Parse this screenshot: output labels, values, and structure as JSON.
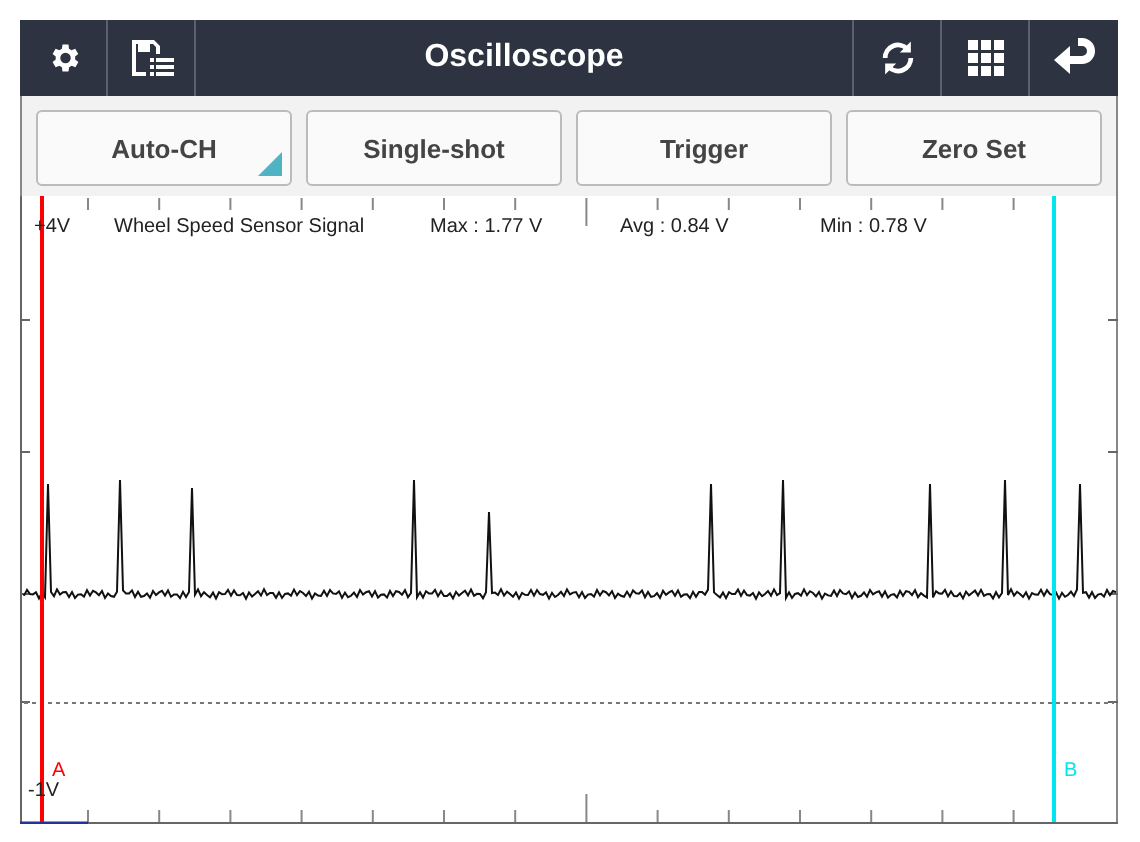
{
  "window": {
    "title": "Oscilloscope"
  },
  "buttons": [
    {
      "label": "Auto-CH",
      "kind": "dropdown"
    },
    {
      "label": "Single-shot",
      "kind": "plain"
    },
    {
      "label": "Trigger",
      "kind": "plain"
    },
    {
      "label": "Zero Set",
      "kind": "plain"
    }
  ],
  "plot": {
    "y_max_label": "+4V",
    "y_min_label": "-1V",
    "signal": "Wheel Speed Sensor Signal",
    "max": "Max : 1.77 V",
    "avg": "Avg : 0.84 V",
    "min": "Min : 0.78 V",
    "cursors": [
      {
        "label": "A",
        "color": "#ff0000"
      },
      {
        "label": "B",
        "color": "#00e5ee"
      }
    ]
  }
}
